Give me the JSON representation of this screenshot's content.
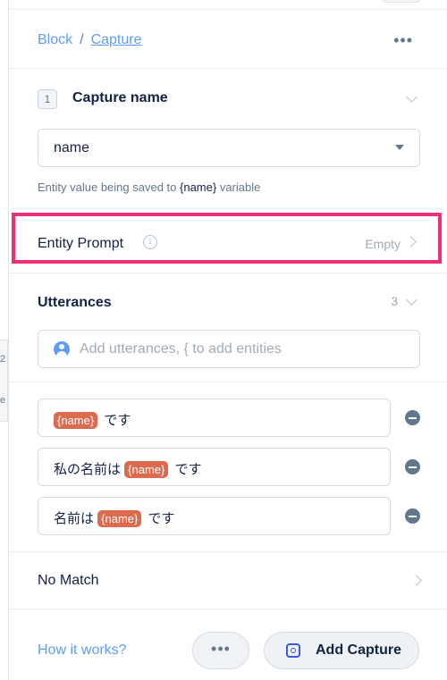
{
  "canvas_edge": {
    "number": "2",
    "letter": "e"
  },
  "breadcrumb": {
    "parent": "Block",
    "separator": "/",
    "current": "Capture"
  },
  "header": {
    "more_label": "•••"
  },
  "capture_name": {
    "step": "1",
    "title": "Capture name",
    "selected_value": "name",
    "helper_prefix": "Entity value being saved to ",
    "helper_variable": "{name}",
    "helper_suffix": " variable"
  },
  "entity_prompt": {
    "label": "Entity Prompt",
    "info_glyph": "i",
    "status": "Empty"
  },
  "utterances": {
    "title": "Utterances",
    "count": "3",
    "placeholder": "Add utterances, { to add entities",
    "items": [
      {
        "before": "",
        "entity": "{name}",
        "after": " です"
      },
      {
        "before": "私の名前は ",
        "entity": "{name}",
        "after": " です"
      },
      {
        "before": "名前は ",
        "entity": "{name}",
        "after": " です"
      }
    ]
  },
  "no_match": {
    "label": "No Match"
  },
  "footer": {
    "how_link": "How it works?",
    "more_label": "•••",
    "add_label": "Add Capture"
  },
  "colors": {
    "accent": "#5d9df5",
    "highlight": "#ef2e7a",
    "entity_tag": "#dc6a4f",
    "text": "#132144"
  }
}
